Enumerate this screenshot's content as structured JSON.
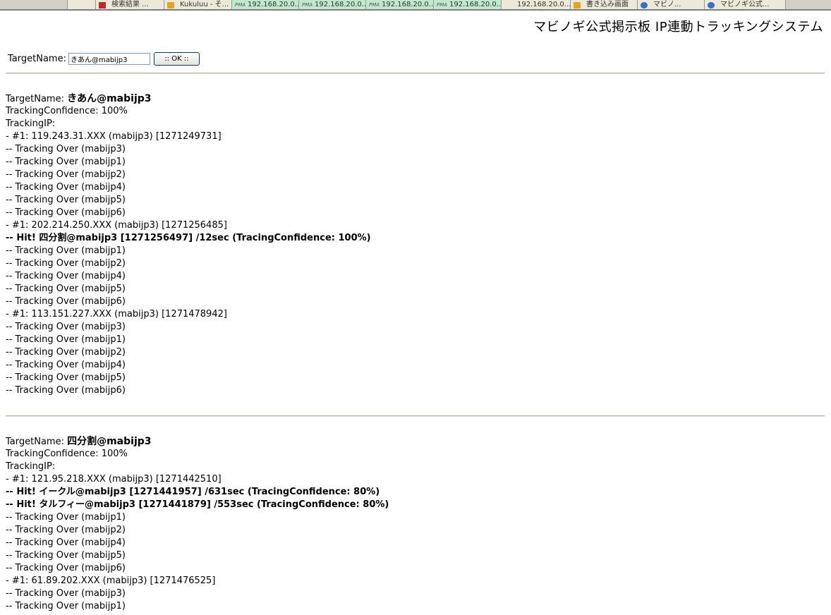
{
  "browser_tabs": [
    {
      "label": "",
      "icon": "window-icon",
      "type": "plain"
    },
    {
      "label": "検索結果 ...",
      "icon": "bookmark-icon",
      "type": "red"
    },
    {
      "label": "Kukuluu - そ...",
      "icon": "star-icon",
      "type": "gold"
    },
    {
      "label": "192.168.20.0...",
      "icon": "pma-icon",
      "type": "pma"
    },
    {
      "label": "192.168.20.0...",
      "icon": "pma-icon",
      "type": "pma"
    },
    {
      "label": "192.168.20.0...",
      "icon": "pma-icon",
      "type": "pma"
    },
    {
      "label": "192.168.20.0...",
      "icon": "pma-icon",
      "type": "pma"
    },
    {
      "label": "192.168.20.0...",
      "icon": "pma-icon",
      "type": "plain"
    },
    {
      "label": "書き込み画面",
      "icon": "star-icon",
      "type": "gold"
    },
    {
      "label": "マビノ...",
      "icon": "ie-icon",
      "type": "blue"
    },
    {
      "label": "マビノギ公式...",
      "icon": "ie-icon",
      "type": "blue"
    }
  ],
  "header": {
    "title": "マビノギ公式掲示板 IP連動トラッキングシステム"
  },
  "search": {
    "label": "TargetName:",
    "value": "きあん@mabijp3",
    "button_label": ":: OK ::"
  },
  "reports": [
    {
      "target_label": "TargetName:",
      "target_name": "きあん@mabijp3",
      "confidence": "TrackingConfidence: 100%",
      "ip_header": "TrackingIP:",
      "lines": [
        {
          "text": "- #1: 119.243.31.XXX (mabijp3) [1271249731]",
          "hit": false
        },
        {
          "text": "-- Tracking Over (mabijp3)",
          "hit": false
        },
        {
          "text": "-- Tracking Over (mabijp1)",
          "hit": false
        },
        {
          "text": "-- Tracking Over (mabijp2)",
          "hit": false
        },
        {
          "text": "-- Tracking Over (mabijp4)",
          "hit": false
        },
        {
          "text": "-- Tracking Over (mabijp5)",
          "hit": false
        },
        {
          "text": "-- Tracking Over (mabijp6)",
          "hit": false
        },
        {
          "text": "- #1: 202.214.250.XXX (mabijp3) [1271256485]",
          "hit": false
        },
        {
          "text": "-- Hit! 四分割@mabijp3 [1271256497] /12sec (TracingConfidence: 100%)",
          "hit": true
        },
        {
          "text": "-- Tracking Over (mabijp1)",
          "hit": false
        },
        {
          "text": "-- Tracking Over (mabijp2)",
          "hit": false
        },
        {
          "text": "-- Tracking Over (mabijp4)",
          "hit": false
        },
        {
          "text": "-- Tracking Over (mabijp5)",
          "hit": false
        },
        {
          "text": "-- Tracking Over (mabijp6)",
          "hit": false
        },
        {
          "text": "- #1: 113.151.227.XXX (mabijp3) [1271478942]",
          "hit": false
        },
        {
          "text": "-- Tracking Over (mabijp3)",
          "hit": false
        },
        {
          "text": "-- Tracking Over (mabijp1)",
          "hit": false
        },
        {
          "text": "-- Tracking Over (mabijp2)",
          "hit": false
        },
        {
          "text": "-- Tracking Over (mabijp4)",
          "hit": false
        },
        {
          "text": "-- Tracking Over (mabijp5)",
          "hit": false
        },
        {
          "text": "-- Tracking Over (mabijp6)",
          "hit": false
        }
      ]
    },
    {
      "target_label": "TargetName:",
      "target_name": "四分割@mabijp3",
      "confidence": "TrackingConfidence: 100%",
      "ip_header": "TrackingIP:",
      "lines": [
        {
          "text": "- #1: 121.95.218.XXX (mabijp3) [1271442510]",
          "hit": false
        },
        {
          "text": "-- Hit! イークル@mabijp3 [1271441957] /631sec (TracingConfidence: 80%)",
          "hit": true
        },
        {
          "text": "-- Hit! タルフィー@mabijp3 [1271441879] /553sec (TracingConfidence: 80%)",
          "hit": true
        },
        {
          "text": "-- Tracking Over (mabijp1)",
          "hit": false
        },
        {
          "text": "-- Tracking Over (mabijp2)",
          "hit": false
        },
        {
          "text": "-- Tracking Over (mabijp4)",
          "hit": false
        },
        {
          "text": "-- Tracking Over (mabijp5)",
          "hit": false
        },
        {
          "text": "-- Tracking Over (mabijp6)",
          "hit": false
        },
        {
          "text": "- #1: 61.89.202.XXX (mabijp3) [1271476525]",
          "hit": false
        },
        {
          "text": "-- Tracking Over (mabijp3)",
          "hit": false
        },
        {
          "text": "-- Tracking Over (mabijp1)",
          "hit": false
        }
      ]
    }
  ]
}
